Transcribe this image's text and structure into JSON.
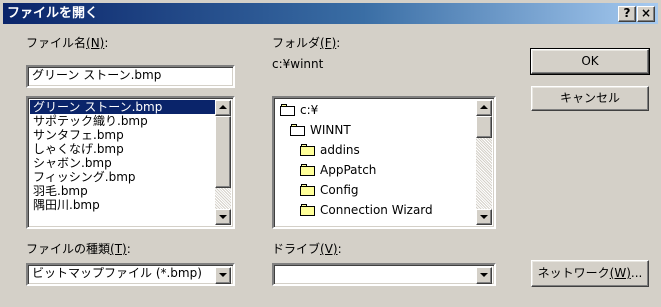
{
  "dialog": {
    "title": "ファイルを開く",
    "help_button": "?",
    "close_button": "×"
  },
  "file_name": {
    "label": "ファイル名",
    "label_access": "(N)",
    "label_suffix": ":",
    "value": "グリーン ストーン.bmp"
  },
  "files": [
    "グリーン ストーン.bmp",
    "サポテック織り.bmp",
    "サンタフェ.bmp",
    "しゃくなげ.bmp",
    "シャボン.bmp",
    "フィッシング.bmp",
    "羽毛.bmp",
    "隅田川.bmp"
  ],
  "folder": {
    "label": "フォルダ",
    "label_access": "(F)",
    "label_suffix": ":",
    "path": "c:¥winnt"
  },
  "folders": [
    {
      "name": "c:¥",
      "icon": "open-folder-icon"
    },
    {
      "name": "WINNT",
      "icon": "open-folder-icon"
    },
    {
      "name": "addins",
      "icon": "folder-icon"
    },
    {
      "name": "AppPatch",
      "icon": "folder-icon"
    },
    {
      "name": "Config",
      "icon": "folder-icon"
    },
    {
      "name": "Connection Wizard",
      "icon": "folder-icon"
    }
  ],
  "file_type": {
    "label": "ファイルの種類",
    "label_access": "(T)",
    "label_suffix": ":",
    "value": "ビットマップファイル (*.bmp)"
  },
  "drive": {
    "label": "ドライブ",
    "label_access": "(V)",
    "label_suffix": ":",
    "value": ""
  },
  "buttons": {
    "ok": "OK",
    "cancel": "キャンセル",
    "network": "ネットワーク",
    "network_access": "(W)",
    "network_suffix": "..."
  },
  "colors": {
    "face": "#d4d0c8",
    "title_start": "#0a246a",
    "title_end": "#a6caf0",
    "selection": "#0a246a"
  }
}
